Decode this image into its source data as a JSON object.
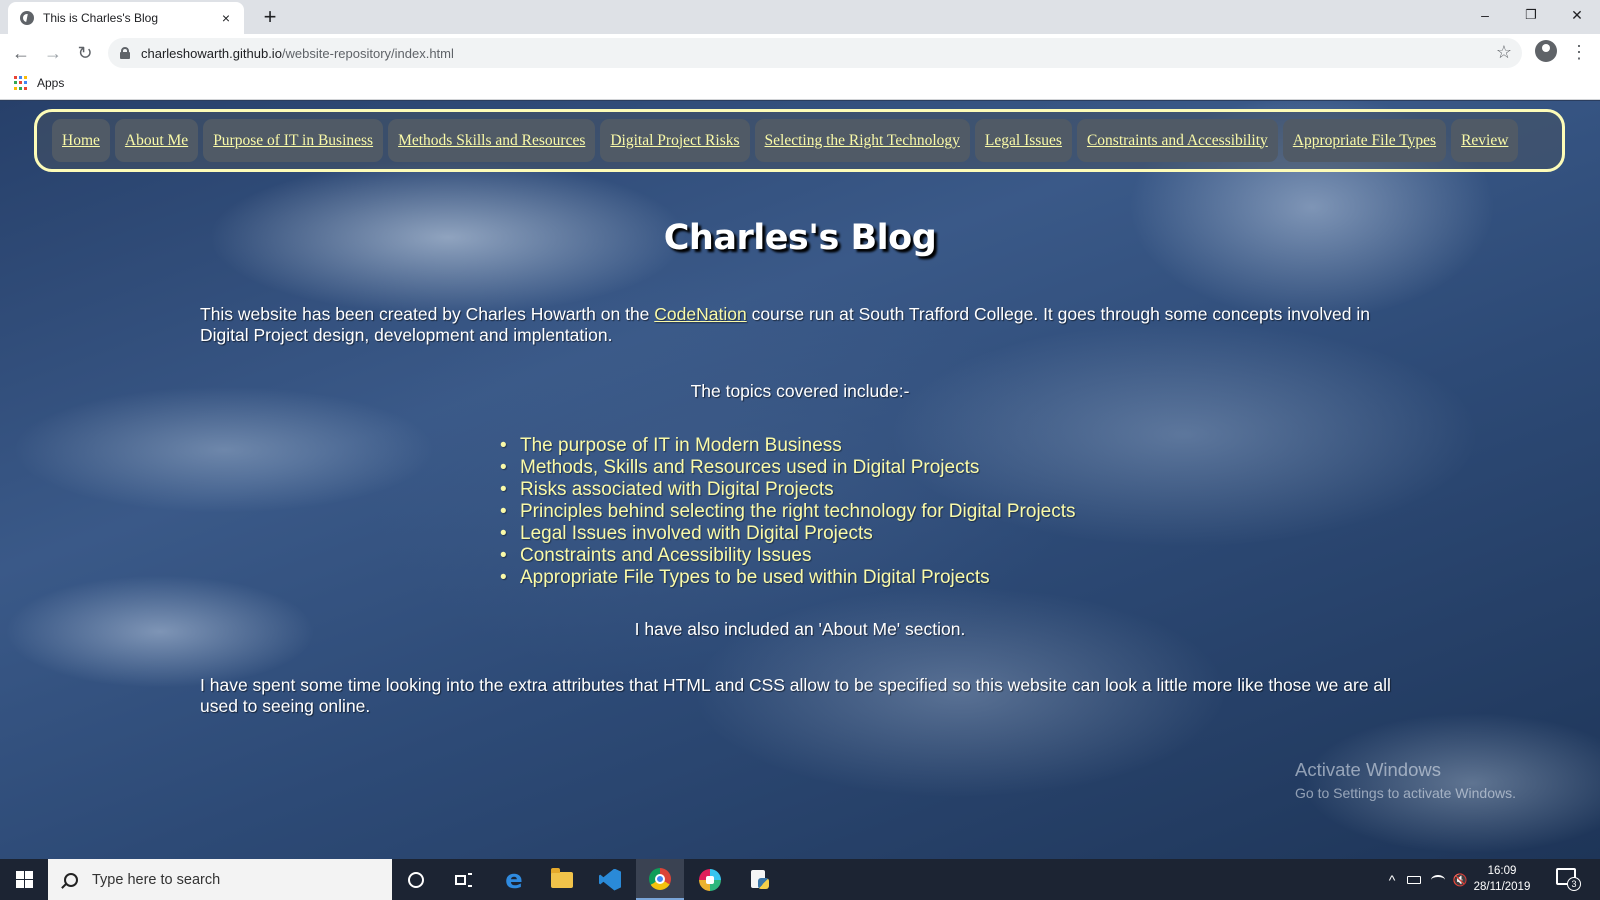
{
  "browser": {
    "tab_title": "This is Charles's Blog",
    "tab_close": "×",
    "new_tab": "+",
    "url_host": "charleshowarth.github.io",
    "url_path": "/website-repository/index.html",
    "bookmarks_apps_label": "Apps",
    "window_controls": {
      "minimize": "–",
      "restore": "❐",
      "close": "✕"
    },
    "nav": {
      "back": "←",
      "forward": "→",
      "reload": "↻",
      "star": "☆",
      "menu": "⋮"
    }
  },
  "site": {
    "nav_links": [
      "Home",
      "About Me",
      "Purpose of IT in Business",
      "Methods Skills and Resources",
      "Digital Project Risks",
      "Selecting the Right Technology",
      "Legal Issues",
      "Constraints and Accessibility",
      "Appropriate File Types",
      "Review"
    ],
    "title": "Charles's Blog",
    "intro_before_link": "This website has been created by Charles Howarth on the ",
    "intro_link": "CodeNation",
    "intro_after_link": " course run at South Trafford College. It goes through some concepts involved in Digital Project design, development and implentation.",
    "topics_heading": "The topics covered include:-",
    "topics": [
      "The purpose of IT in Modern Business",
      "Methods, Skills and Resources used in Digital Projects",
      "Risks associated with Digital Projects",
      "Principles behind selecting the right technology for Digital Projects",
      "Legal Issues involved with Digital Projects",
      "Constraints and Acessibility Issues",
      "Appropriate File Types to be used within Digital Projects"
    ],
    "about_note": "I have also included an 'About Me' section.",
    "closing": "I have spent some time looking into the extra attributes that HTML and CSS allow to be specified so this website can look a little more like those we are all used to seeing online.",
    "colors": {
      "link_yellow": "#fafaa8",
      "nav_border": "#fdfcb8",
      "nav_button": "#505a66"
    }
  },
  "watermark": {
    "line1": "Activate Windows",
    "line2": "Go to Settings to activate Windows."
  },
  "taskbar": {
    "search_placeholder": "Type here to search",
    "time": "16:09",
    "date": "28/11/2019",
    "notification_count": "3",
    "tray": {
      "chevron": "^",
      "volume": "🔇"
    }
  }
}
